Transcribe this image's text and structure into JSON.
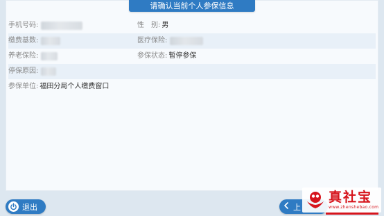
{
  "header": {
    "title": "请确认当前个人参保信息"
  },
  "info": {
    "phone_label": "手机号码:",
    "gender_label": "性　别:",
    "gender_value": "男",
    "base_label": "缴费基数:",
    "medical_label": "医疗保险:",
    "pension_label": "养老保险:",
    "status_label": "参保状态:",
    "status_value": "暂停参保",
    "stop_reason_label": "停保原因:",
    "unit_label": "参保单位:",
    "unit_value": "福田分局个人缴费窗口"
  },
  "footer": {
    "exit_label": "退出",
    "prev_label": "上"
  },
  "watermark": {
    "name": "真社宝",
    "url": "www.zhenshebao.com"
  },
  "colors": {
    "primary": "#2f7bc3",
    "accent_red": "#d6141c",
    "row_alt": "#e8f0f8"
  },
  "icons": {
    "exit": "power-icon",
    "prev": "chevron-left-icon"
  }
}
